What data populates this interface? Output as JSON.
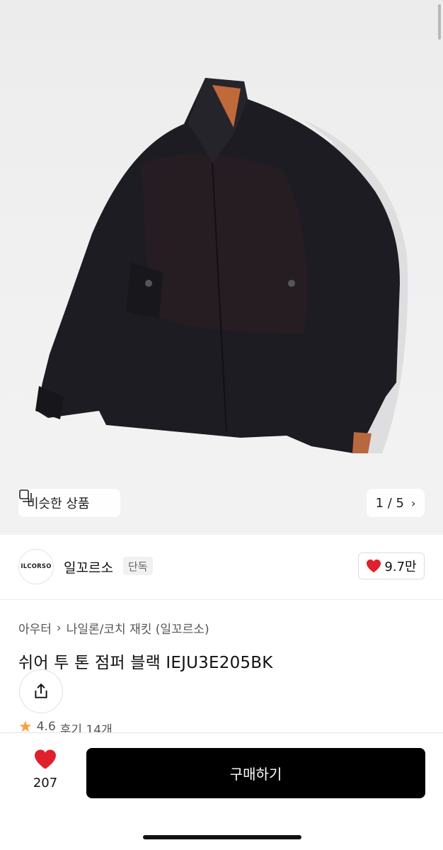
{
  "product_image": {
    "alt": "jacket-photo",
    "similar_label": "비슷한 상품",
    "counter": "1 / 5"
  },
  "brand": {
    "logo_text": "ILCORSO",
    "name": "일꼬르소",
    "badge": "단독",
    "likes": "9.7만"
  },
  "breadcrumb": {
    "category": "아우터",
    "subcategory": "나일론/코치 재킷 (일꼬르소)"
  },
  "product": {
    "title": "쉬어 투 톤 점퍼 블랙 IEJU3E205BK"
  },
  "rating": {
    "score": "4.6",
    "reviews": "후기 14개"
  },
  "bottom_bar": {
    "wish_count": "207",
    "buy_label": "구매하기"
  },
  "colors": {
    "heart": "#e0202c",
    "star": "#f2a33a",
    "buy_button": "#000000"
  }
}
